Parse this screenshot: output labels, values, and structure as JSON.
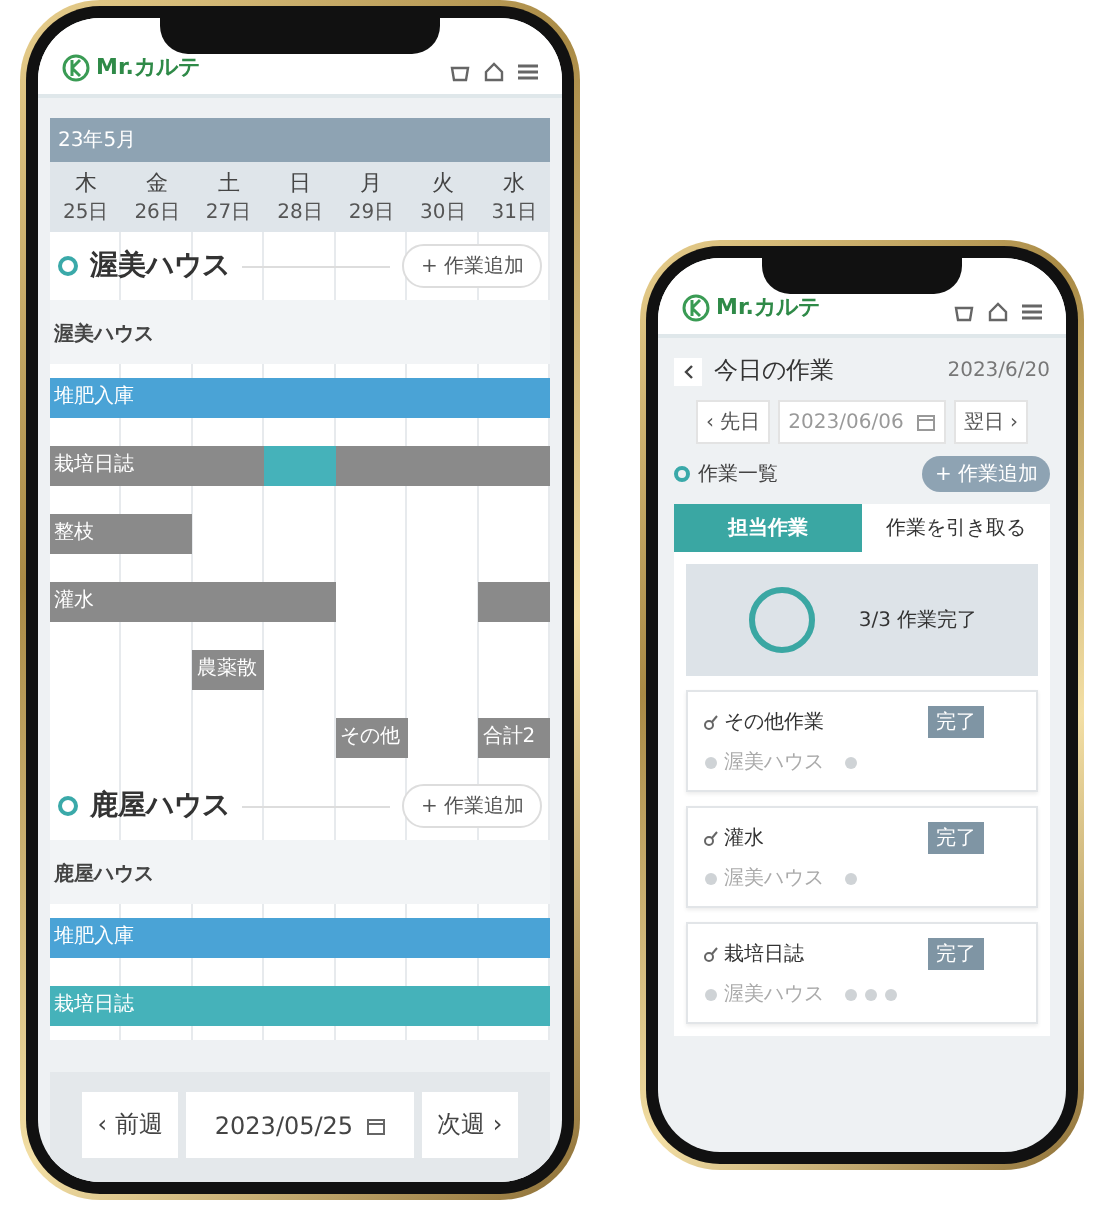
{
  "calendar_phone": {
    "header": {
      "brand": "Mr.カルテ"
    },
    "month": "23年5月",
    "days": [
      {
        "weekday": "木",
        "date": "25日"
      },
      {
        "weekday": "金",
        "date": "26日"
      },
      {
        "weekday": "土",
        "date": "27日"
      },
      {
        "weekday": "日",
        "date": "28日"
      },
      {
        "weekday": "月",
        "date": "29日"
      },
      {
        "weekday": "火",
        "date": "30日"
      },
      {
        "weekday": "水",
        "date": "31日"
      }
    ],
    "houses": [
      {
        "name": "渥美ハウス",
        "add_button": "+ 作業追加",
        "sub_label": "渥美ハウス",
        "rows": [
          {
            "slots": [
              {
                "filled": true,
                "color": "#4aa3d6",
                "label": "堆肥入庫"
              },
              {
                "filled": true,
                "color": "#4aa3d6"
              },
              {
                "filled": true,
                "color": "#4aa3d6"
              },
              {
                "filled": true,
                "color": "#4aa3d6"
              },
              {
                "filled": true,
                "color": "#4aa3d6"
              },
              {
                "filled": true,
                "color": "#4aa3d6"
              },
              {
                "filled": true,
                "color": "#4aa3d6"
              }
            ]
          },
          {
            "slots": [
              {
                "filled": true,
                "color": "#8a8a8a",
                "label": "栽培日誌"
              },
              {
                "filled": true,
                "color": "#8a8a8a"
              },
              {
                "filled": true,
                "color": "#8a8a8a"
              },
              {
                "filled": true,
                "color": "#45b2ba"
              },
              {
                "filled": true,
                "color": "#8a8a8a"
              },
              {
                "filled": true,
                "color": "#8a8a8a"
              },
              {
                "filled": true,
                "color": "#8a8a8a"
              }
            ]
          },
          {
            "slots": [
              {
                "filled": true,
                "color": "#8a8a8a",
                "label": "整枝"
              },
              {
                "filled": true,
                "color": "#8a8a8a"
              },
              {
                "filled": false
              },
              {
                "filled": false
              },
              {
                "filled": false
              },
              {
                "filled": false
              },
              {
                "filled": false
              }
            ]
          },
          {
            "slots": [
              {
                "filled": true,
                "color": "#8a8a8a",
                "label": "灌水"
              },
              {
                "filled": true,
                "color": "#8a8a8a"
              },
              {
                "filled": true,
                "color": "#8a8a8a"
              },
              {
                "filled": true,
                "color": "#8a8a8a"
              },
              {
                "filled": false
              },
              {
                "filled": false
              },
              {
                "filled": true,
                "color": "#8a8a8a"
              }
            ]
          },
          {
            "slots": [
              {
                "filled": false
              },
              {
                "filled": false
              },
              {
                "filled": true,
                "color": "#8a8a8a",
                "label": "農薬散"
              },
              {
                "filled": false
              },
              {
                "filled": false
              },
              {
                "filled": false
              },
              {
                "filled": false
              }
            ]
          },
          {
            "slots": [
              {
                "filled": false
              },
              {
                "filled": false
              },
              {
                "filled": false
              },
              {
                "filled": false
              },
              {
                "filled": true,
                "color": "#8a8a8a",
                "label": "その他"
              },
              {
                "filled": false
              },
              {
                "filled": true,
                "color": "#8a8a8a",
                "label": "合計2"
              }
            ]
          }
        ]
      },
      {
        "name": "鹿屋ハウス",
        "add_button": "+ 作業追加",
        "sub_label": "鹿屋ハウス",
        "rows": [
          {
            "slots": [
              {
                "filled": true,
                "color": "#4aa3d6",
                "label": "堆肥入庫"
              },
              {
                "filled": true,
                "color": "#4aa3d6"
              },
              {
                "filled": true,
                "color": "#4aa3d6"
              },
              {
                "filled": true,
                "color": "#4aa3d6"
              },
              {
                "filled": true,
                "color": "#4aa3d6"
              },
              {
                "filled": true,
                "color": "#4aa3d6"
              },
              {
                "filled": true,
                "color": "#4aa3d6"
              }
            ]
          },
          {
            "slots": [
              {
                "filled": true,
                "color": "#45b2ba",
                "label": "栽培日誌"
              },
              {
                "filled": true,
                "color": "#45b2ba"
              },
              {
                "filled": true,
                "color": "#45b2ba"
              },
              {
                "filled": true,
                "color": "#45b2ba"
              },
              {
                "filled": true,
                "color": "#45b2ba"
              },
              {
                "filled": true,
                "color": "#45b2ba"
              },
              {
                "filled": true,
                "color": "#45b2ba"
              }
            ]
          }
        ]
      }
    ],
    "footer": {
      "prev": "‹ 前週",
      "date": "2023/05/25",
      "next": "次週 ›"
    }
  },
  "today_phone": {
    "header": {
      "brand": "Mr.カルテ"
    },
    "title": "今日の作業",
    "date": "2023/6/20",
    "nav": {
      "prev": "‹ 先日",
      "date": "2023/06/06",
      "next": "翌日 ›"
    },
    "section": "作業一覧",
    "add_button": "+ 作業追加",
    "tabs": [
      {
        "label": "担当作業",
        "selected": true
      },
      {
        "label": "作業を引き取る",
        "selected": false
      }
    ],
    "progress": {
      "level": 1,
      "text": "3/3 作業完了"
    },
    "tasks": [
      {
        "title": "その他作業",
        "house": "渥美ハウス",
        "status": "完了",
        "markers": [
          {
            "kind": "dot"
          }
        ]
      },
      {
        "title": "灌水",
        "house": "渥美ハウス",
        "status": "完了",
        "markers": [
          {
            "kind": "dot"
          }
        ]
      },
      {
        "title": "栽培日誌",
        "house": "渥美ハウス",
        "status": "完了",
        "markers": [
          {
            "kind": "dot"
          },
          {
            "kind": "dot"
          },
          {
            "kind": "dot"
          }
        ]
      }
    ]
  }
}
